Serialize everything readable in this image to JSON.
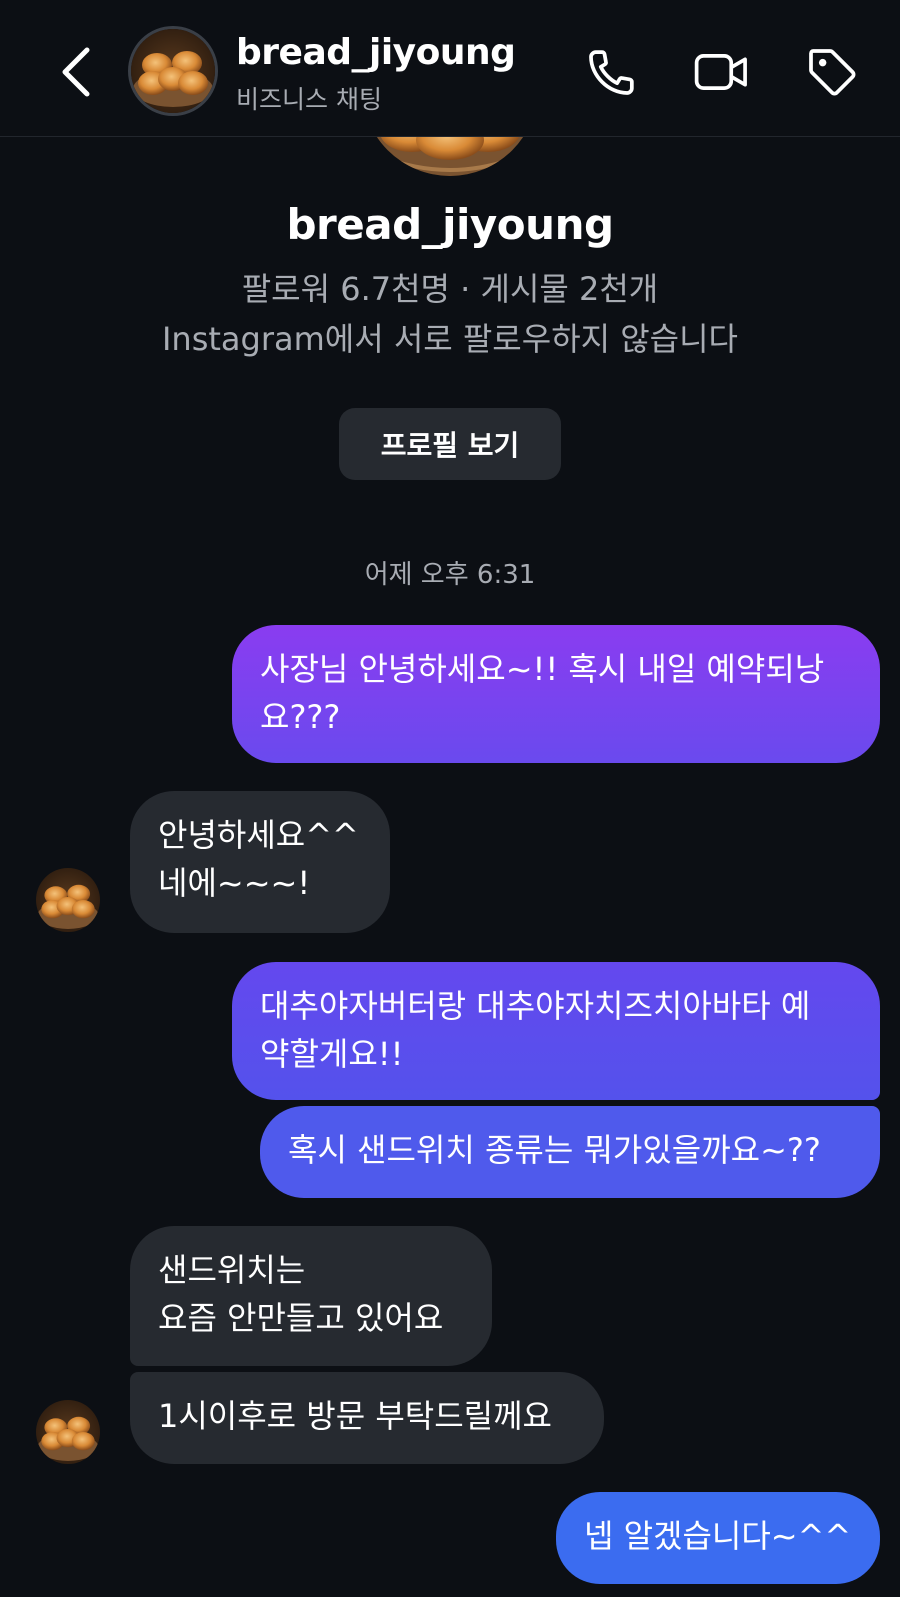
{
  "header": {
    "username": "bread_jiyoung",
    "subtitle": "비즈니스 채팅",
    "icons": [
      "back-chevron-icon",
      "phone-icon",
      "video-camera-icon",
      "tag-icon"
    ]
  },
  "profile": {
    "name": "bread_jiyoung",
    "stats": "팔로워 6.7천명 · 게시물 2천개",
    "follow_status": "Instagram에서 서로 팔로우하지 않습니다",
    "view_profile_label": "프로필 보기"
  },
  "timestamp": "어제 오후 6:31",
  "messages": [
    {
      "from": "me",
      "text": "사장님 안녕하세요~!! 혹시 내일 예약되낭\n요???"
    },
    {
      "from": "them",
      "text": "안녕하세요^^\n네에~~~!"
    },
    {
      "from": "me",
      "text": "대추야자버터랑 대추야자치즈치아바타 예\n약할게요!!"
    },
    {
      "from": "me",
      "text": "혹시 샌드위치 종류는 뭐가있을까요~??"
    },
    {
      "from": "them",
      "text": "샌드위치는\n요즘 안만들고 있어요"
    },
    {
      "from": "them",
      "text": "1시이후로 방문 부탁드릴께요"
    },
    {
      "from": "me",
      "text": "넵 알겠습니다~^^"
    }
  ],
  "colors": {
    "background": "#0c0f14",
    "received_bubble": "#262a30",
    "sent_gradient_top": "#8a3cf0",
    "sent_gradient_mid": "#5a52ec",
    "sent_gradient_bottom": "#3b6cf0",
    "muted_text": "#a8acb3"
  }
}
